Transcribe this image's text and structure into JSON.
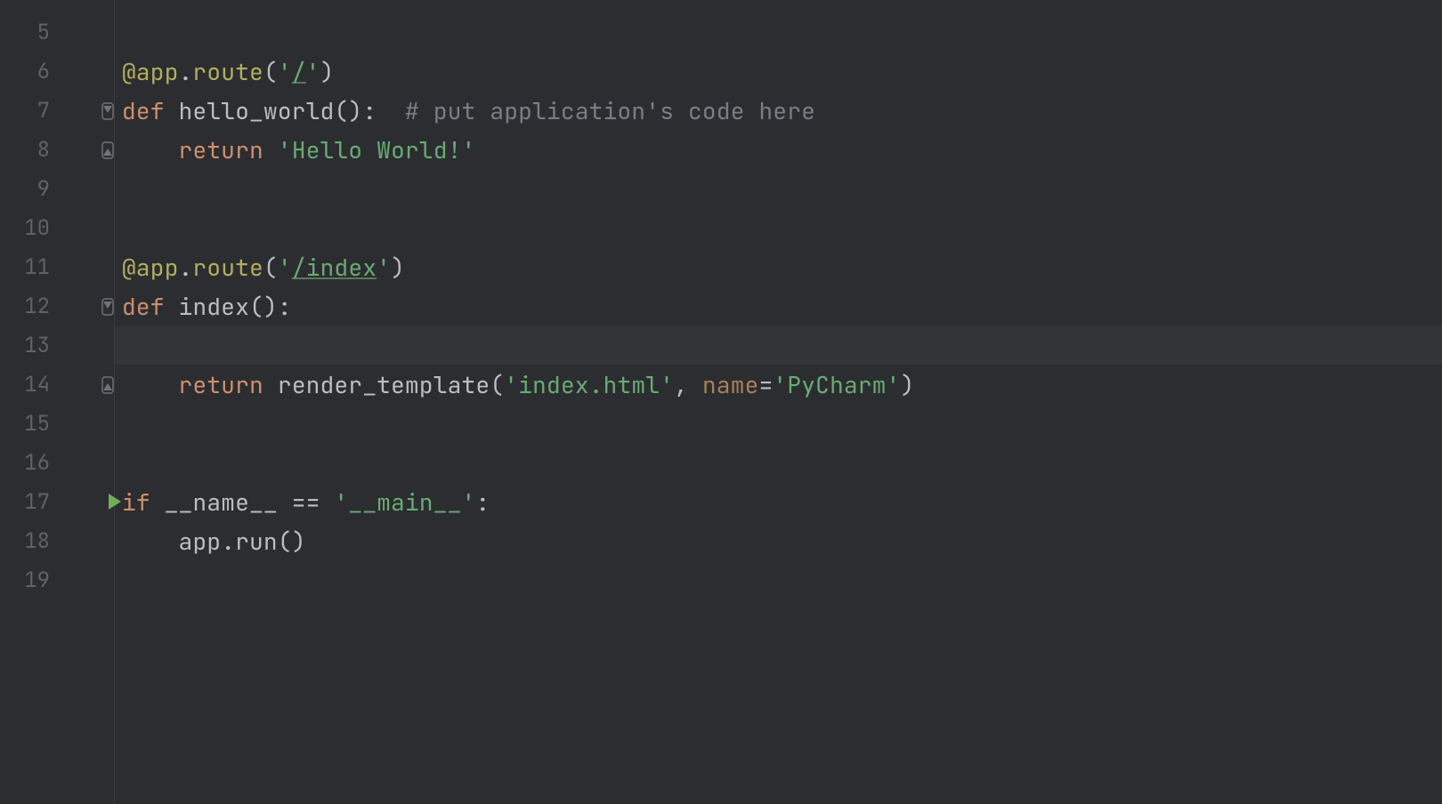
{
  "editor": {
    "first_line_number": 5,
    "current_line": 13,
    "run_marker_line": 17,
    "fold_open_lines": [
      7,
      12
    ],
    "fold_close_lines": [
      8,
      14
    ],
    "lines": [
      {
        "n": 5,
        "tokens": []
      },
      {
        "n": 6,
        "tokens": [
          {
            "t": "@app",
            "c": "tk-decorator"
          },
          {
            "t": ".",
            "c": "tk-punct"
          },
          {
            "t": "route",
            "c": "tk-decorator"
          },
          {
            "t": "(",
            "c": "tk-paren"
          },
          {
            "t": "'",
            "c": "tk-string"
          },
          {
            "t": "/",
            "c": "tk-string-underline"
          },
          {
            "t": "'",
            "c": "tk-string"
          },
          {
            "t": ")",
            "c": "tk-paren"
          }
        ]
      },
      {
        "n": 7,
        "tokens": [
          {
            "t": "def ",
            "c": "tk-keyword"
          },
          {
            "t": "hello_world",
            "c": "tk-funcname"
          },
          {
            "t": "():",
            "c": "tk-paren"
          },
          {
            "t": "  ",
            "c": ""
          },
          {
            "t": "# put application's code here",
            "c": "tk-comment"
          }
        ]
      },
      {
        "n": 8,
        "tokens": [
          {
            "t": "    ",
            "c": ""
          },
          {
            "t": "return ",
            "c": "tk-keyword"
          },
          {
            "t": "'Hello World!'",
            "c": "tk-string"
          }
        ]
      },
      {
        "n": 9,
        "tokens": []
      },
      {
        "n": 10,
        "tokens": []
      },
      {
        "n": 11,
        "tokens": [
          {
            "t": "@app",
            "c": "tk-decorator"
          },
          {
            "t": ".",
            "c": "tk-punct"
          },
          {
            "t": "route",
            "c": "tk-decorator"
          },
          {
            "t": "(",
            "c": "tk-paren"
          },
          {
            "t": "'",
            "c": "tk-string"
          },
          {
            "t": "/index",
            "c": "tk-string-underline"
          },
          {
            "t": "'",
            "c": "tk-string"
          },
          {
            "t": ")",
            "c": "tk-paren"
          }
        ]
      },
      {
        "n": 12,
        "tokens": [
          {
            "t": "def ",
            "c": "tk-keyword"
          },
          {
            "t": "index",
            "c": "tk-funcname"
          },
          {
            "t": "():",
            "c": "tk-paren"
          }
        ]
      },
      {
        "n": 13,
        "tokens": []
      },
      {
        "n": 14,
        "tokens": [
          {
            "t": "    ",
            "c": ""
          },
          {
            "t": "return ",
            "c": "tk-keyword"
          },
          {
            "t": "render_template",
            "c": "tk-call"
          },
          {
            "t": "(",
            "c": "tk-paren"
          },
          {
            "t": "'index.html'",
            "c": "tk-string"
          },
          {
            "t": ", ",
            "c": "tk-punct"
          },
          {
            "t": "name",
            "c": "tk-kwarg"
          },
          {
            "t": "=",
            "c": "tk-punct"
          },
          {
            "t": "'PyCharm'",
            "c": "tk-string"
          },
          {
            "t": ")",
            "c": "tk-paren"
          }
        ]
      },
      {
        "n": 15,
        "tokens": []
      },
      {
        "n": 16,
        "tokens": []
      },
      {
        "n": 17,
        "tokens": [
          {
            "t": "if ",
            "c": "tk-keyword"
          },
          {
            "t": "__name__",
            "c": "tk-builtin"
          },
          {
            "t": " == ",
            "c": "tk-punct"
          },
          {
            "t": "'__main__'",
            "c": "tk-string"
          },
          {
            "t": ":",
            "c": "tk-punct"
          }
        ]
      },
      {
        "n": 18,
        "tokens": [
          {
            "t": "    ",
            "c": ""
          },
          {
            "t": "app",
            "c": "tk-identifier"
          },
          {
            "t": ".",
            "c": "tk-punct"
          },
          {
            "t": "run",
            "c": "tk-call"
          },
          {
            "t": "()",
            "c": "tk-paren"
          }
        ]
      },
      {
        "n": 19,
        "tokens": []
      }
    ]
  }
}
